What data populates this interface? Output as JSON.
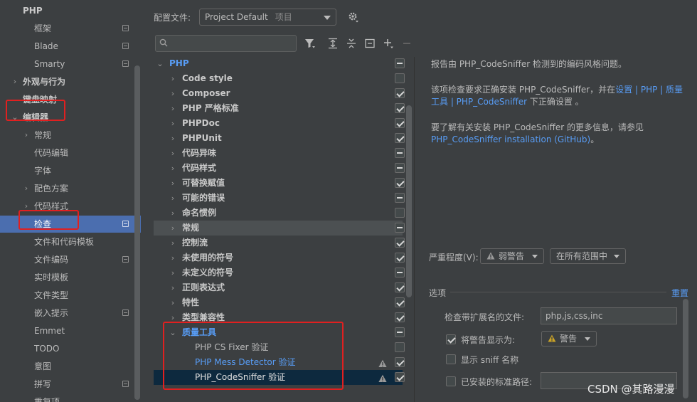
{
  "sidebar": {
    "items": [
      {
        "label": "PHP",
        "arrow": "",
        "bold": true,
        "icon": false
      },
      {
        "label": "框架",
        "arrow": "",
        "bold": false,
        "icon": true
      },
      {
        "label": "Blade",
        "arrow": "",
        "bold": false,
        "icon": true
      },
      {
        "label": "Smarty",
        "arrow": "",
        "bold": false,
        "icon": true
      },
      {
        "label": "外观与行为",
        "arrow": "›",
        "bold": true,
        "icon": false
      },
      {
        "label": "键盘映射",
        "arrow": "",
        "bold": true,
        "icon": false
      },
      {
        "label": "编辑器",
        "arrow": "⌄",
        "bold": true,
        "icon": false
      },
      {
        "label": "常规",
        "arrow": "›",
        "bold": false,
        "icon": false
      },
      {
        "label": "代码编辑",
        "arrow": "",
        "bold": false,
        "icon": false
      },
      {
        "label": "字体",
        "arrow": "",
        "bold": false,
        "icon": false
      },
      {
        "label": "配色方案",
        "arrow": "›",
        "bold": false,
        "icon": false
      },
      {
        "label": "代码样式",
        "arrow": "›",
        "bold": false,
        "icon": false
      },
      {
        "label": "检查",
        "arrow": "",
        "bold": false,
        "icon": true,
        "selected": true
      },
      {
        "label": "文件和代码模板",
        "arrow": "",
        "bold": false,
        "icon": false
      },
      {
        "label": "文件编码",
        "arrow": "",
        "bold": false,
        "icon": true
      },
      {
        "label": "实时模板",
        "arrow": "",
        "bold": false,
        "icon": false
      },
      {
        "label": "文件类型",
        "arrow": "",
        "bold": false,
        "icon": false
      },
      {
        "label": "嵌入提示",
        "arrow": "",
        "bold": false,
        "icon": true
      },
      {
        "label": "Emmet",
        "arrow": "",
        "bold": false,
        "icon": false
      },
      {
        "label": "TODO",
        "arrow": "",
        "bold": false,
        "icon": false
      },
      {
        "label": "意图",
        "arrow": "",
        "bold": false,
        "icon": false
      },
      {
        "label": "拼写",
        "arrow": "",
        "bold": false,
        "icon": true
      },
      {
        "label": "重复项",
        "arrow": "",
        "bold": false,
        "icon": false
      }
    ]
  },
  "profile": {
    "label": "配置文件:",
    "value": "Project Default",
    "sub": "项目"
  },
  "search": {
    "placeholder": ""
  },
  "toolbar": {
    "filter_icon": "filter-icon",
    "expand_icon": "expand-all-icon",
    "collapse_icon": "collapse-all-icon",
    "reset_icon": "reset-icon",
    "add_icon": "add-icon",
    "remove_icon": "remove-icon"
  },
  "tree": {
    "rows": [
      {
        "label": "PHP",
        "depth": 0,
        "arrow": "⌄",
        "style": "blueb",
        "check": "mixed"
      },
      {
        "label": "Code style",
        "depth": 1,
        "arrow": "›",
        "style": "b",
        "check": "none"
      },
      {
        "label": "Composer",
        "depth": 1,
        "arrow": "›",
        "style": "b",
        "check": "checked"
      },
      {
        "label": "PHP 严格标准",
        "depth": 1,
        "arrow": "›",
        "style": "b",
        "check": "checked"
      },
      {
        "label": "PHPDoc",
        "depth": 1,
        "arrow": "›",
        "style": "b",
        "check": "checked"
      },
      {
        "label": "PHPUnit",
        "depth": 1,
        "arrow": "›",
        "style": "b",
        "check": "checked"
      },
      {
        "label": "代码异味",
        "depth": 1,
        "arrow": "›",
        "style": "b",
        "check": "mixed"
      },
      {
        "label": "代码样式",
        "depth": 1,
        "arrow": "›",
        "style": "b",
        "check": "mixed"
      },
      {
        "label": "可替换赋值",
        "depth": 1,
        "arrow": "›",
        "style": "b",
        "check": "checked"
      },
      {
        "label": "可能的错误",
        "depth": 1,
        "arrow": "›",
        "style": "b",
        "check": "mixed"
      },
      {
        "label": "命名惯例",
        "depth": 1,
        "arrow": "›",
        "style": "b",
        "check": "none"
      },
      {
        "label": "常规",
        "depth": 1,
        "arrow": "›",
        "style": "b",
        "check": "mixed",
        "hl": true
      },
      {
        "label": "控制流",
        "depth": 1,
        "arrow": "›",
        "style": "b",
        "check": "checked"
      },
      {
        "label": "未使用的符号",
        "depth": 1,
        "arrow": "›",
        "style": "b",
        "check": "checked"
      },
      {
        "label": "未定义的符号",
        "depth": 1,
        "arrow": "›",
        "style": "b",
        "check": "mixed"
      },
      {
        "label": "正则表达式",
        "depth": 1,
        "arrow": "›",
        "style": "b",
        "check": "checked"
      },
      {
        "label": "特性",
        "depth": 1,
        "arrow": "›",
        "style": "b",
        "check": "checked"
      },
      {
        "label": "类型兼容性",
        "depth": 1,
        "arrow": "›",
        "style": "b",
        "check": "checked"
      },
      {
        "label": "质量工具",
        "depth": 1,
        "arrow": "⌄",
        "style": "blueb",
        "check": "mixed"
      },
      {
        "label": "PHP CS Fixer 验证",
        "depth": 2,
        "arrow": "",
        "style": "",
        "check": "none"
      },
      {
        "label": "PHP Mess Detector 验证",
        "depth": 2,
        "arrow": "",
        "style": "blue",
        "check": "checked",
        "warn": true
      },
      {
        "label": "PHP_CodeSniffer 验证",
        "depth": 2,
        "arrow": "",
        "style": "white",
        "check": "checked",
        "warn": true,
        "sel": true
      }
    ]
  },
  "description": {
    "p1": "报告由 PHP_CodeSniffer 检测到的编码风格问题。",
    "p2_pre": "该项检查要求正确安装 PHP_CodeSniffer，并在",
    "p2_link": "设置 | PHP | 质量工具 | PHP_CodeSniffer",
    "p2_post": " 下正确设置 。",
    "p3_pre": "要了解有关安装 PHP_CodeSniffer 的更多信息，请参见",
    "p3_link": "PHP_CodeSniffer installation (GitHub)",
    "p3_post": "。"
  },
  "severity": {
    "label": "严重程度(V):",
    "value": "弱警告",
    "scope": "在所有范围中"
  },
  "options": {
    "title": "选项",
    "reset": "重置",
    "ext_label": "检查带扩展名的文件:",
    "ext_value": "php,js,css,inc",
    "show_warn_label": "将警告显示为:",
    "show_warn_value": "警告",
    "show_sniff_label": "显示 sniff 名称",
    "installed_path_label": "已安装的标准路径:"
  },
  "watermark": "CSDN @其路漫漫",
  "colors": {
    "accent": "#4b6eaf",
    "link": "#589df6",
    "highlight_border": "#e02020",
    "warning": "#c9a227"
  }
}
